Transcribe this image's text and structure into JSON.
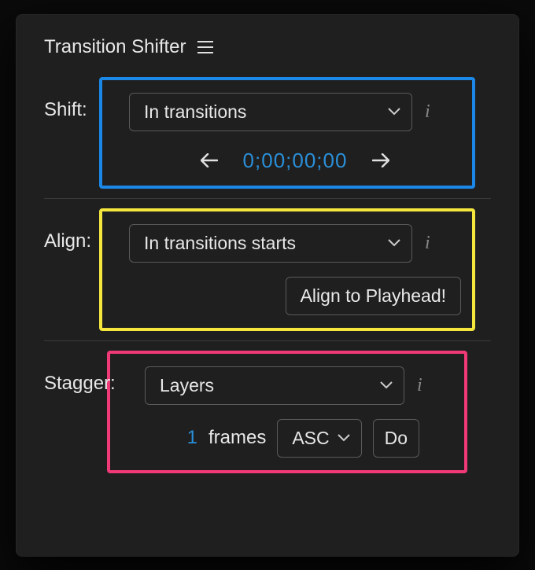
{
  "panel": {
    "title": "Transition Shifter"
  },
  "shift": {
    "label": "Shift:",
    "dropdown": "In transitions",
    "timecode": "0;00;00;00"
  },
  "align": {
    "label": "Align:",
    "dropdown": "In transitions starts",
    "button": "Align to Playhead!"
  },
  "stagger": {
    "label": "Stagger:",
    "dropdown": "Layers",
    "frames_value": "1",
    "frames_label": "frames",
    "order": "ASC",
    "do_button": "Do"
  }
}
